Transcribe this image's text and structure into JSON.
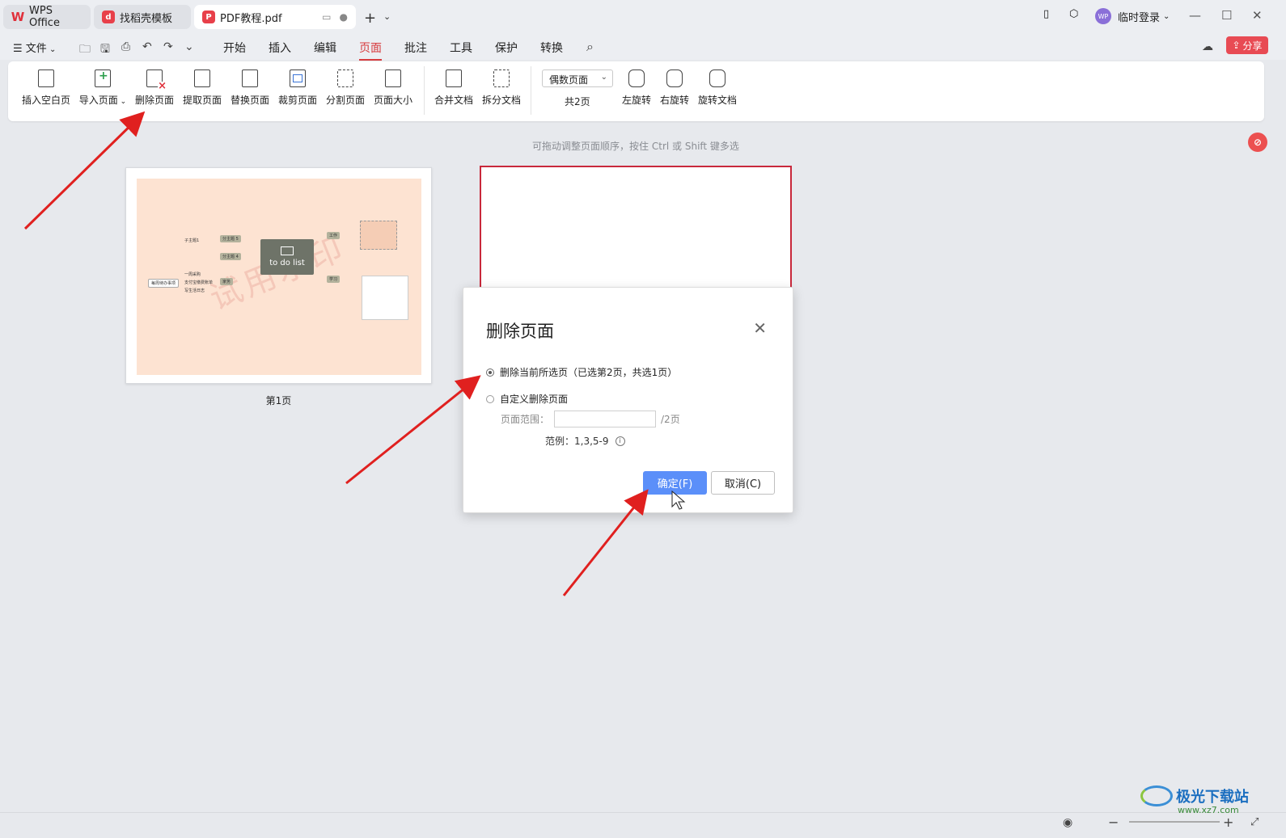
{
  "tabs": [
    {
      "label": "WPS Office",
      "icon": "wps-logo-icon"
    },
    {
      "label": "找稻壳模板",
      "icon": "docer-icon"
    },
    {
      "label": "PDF教程.pdf",
      "icon": "pdf-icon",
      "active": true
    }
  ],
  "user": {
    "login_label": "临时登录",
    "avatar_text": "WP"
  },
  "menubar": {
    "file_label": "文件",
    "items": [
      "开始",
      "插入",
      "编辑",
      "页面",
      "批注",
      "工具",
      "保护",
      "转换"
    ],
    "active": "页面",
    "share_label": "分享"
  },
  "ribbon": {
    "buttons": [
      "插入空白页",
      "导入页面",
      "删除页面",
      "提取页面",
      "替换页面",
      "裁剪页面",
      "分割页面",
      "页面大小",
      "合并文档",
      "拆分文档",
      "左旋转",
      "右旋转",
      "旋转文档"
    ],
    "page_select": "偶数页面",
    "page_count": "共2页"
  },
  "hint": "可拖动调整页面顺序，按住 Ctrl 或 Shift 键多选",
  "thumbnail": {
    "page1_label": "第1页",
    "center_text": "to do list",
    "watermark": "试用水印",
    "nodes": [
      "子主题1",
      "分主题 5",
      "分主题 4",
      "工作",
      "学习",
      "家务",
      "每周待办事项",
      "一周采购",
      "支付宝缴费账单",
      "写生活日志"
    ]
  },
  "dialog": {
    "title": "删除页面",
    "option1": "删除当前所选页（已选第2页，共选1页）",
    "option2": "自定义删除页面",
    "range_label": "页面范围：",
    "range_value": "",
    "range_suffix": "/2页",
    "example": "范例：1,3,5-9",
    "ok_label": "确定(F)",
    "cancel_label": "取消(C)"
  },
  "watermark_site": {
    "name": "极光下载站",
    "url": "www.xz7.com"
  },
  "colors": {
    "accent": "#d73b3e",
    "ok_button": "#5b8ff9",
    "arrow": "#e0201f",
    "share": "#e84b54"
  }
}
